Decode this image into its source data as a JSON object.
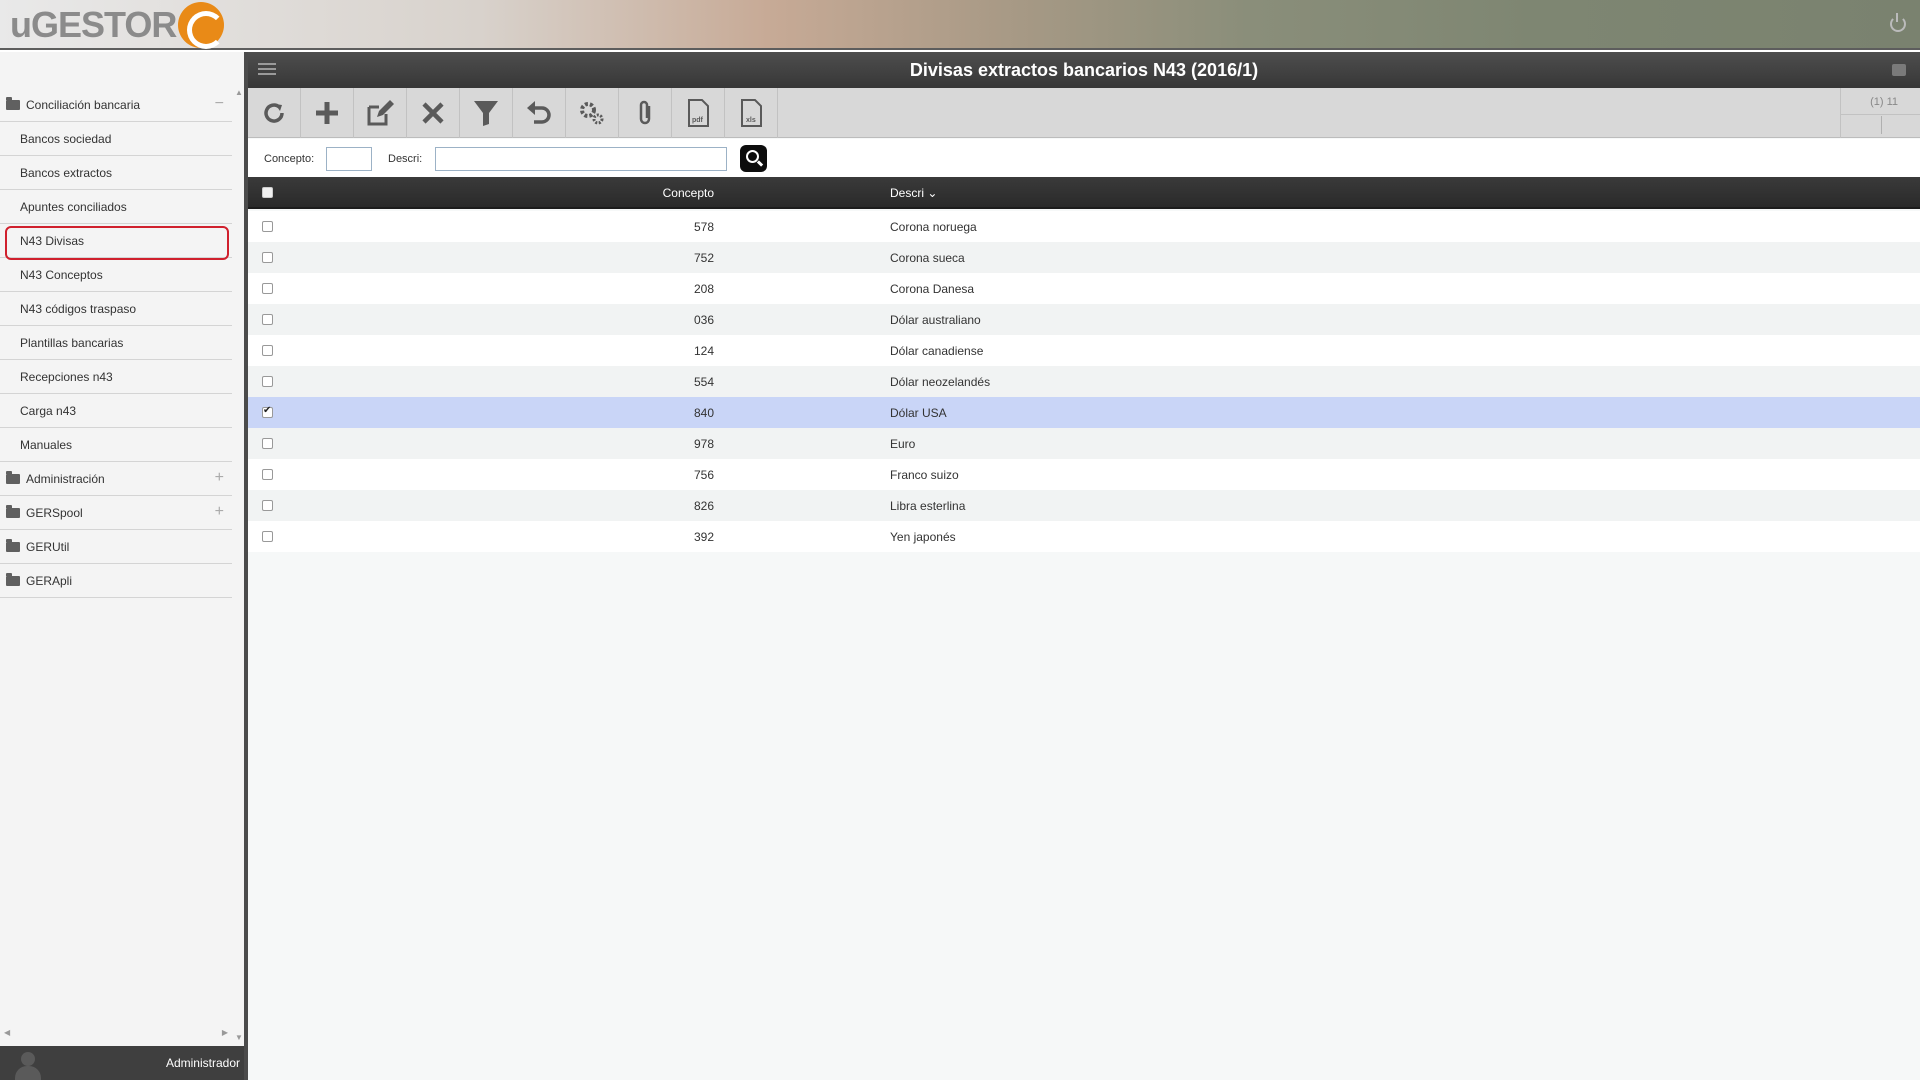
{
  "app": {
    "logo_text": "uGESTOR",
    "user_name": "Administrador"
  },
  "sidebar": {
    "items": [
      {
        "label": "Conciliación bancaria",
        "type": "group",
        "toggle": "−"
      },
      {
        "label": "Bancos sociedad",
        "type": "child"
      },
      {
        "label": "Bancos extractos",
        "type": "child"
      },
      {
        "label": "Apuntes conciliados",
        "type": "child"
      },
      {
        "label": "N43 Divisas",
        "type": "child",
        "selected": true
      },
      {
        "label": "N43 Conceptos",
        "type": "child"
      },
      {
        "label": "N43 códigos traspaso",
        "type": "child"
      },
      {
        "label": "Plantillas bancarias",
        "type": "child"
      },
      {
        "label": "Recepciones n43",
        "type": "child"
      },
      {
        "label": "Carga n43",
        "type": "child"
      },
      {
        "label": "Manuales",
        "type": "child"
      },
      {
        "label": "Administración",
        "type": "group",
        "toggle": "+"
      },
      {
        "label": "GERSpool",
        "type": "group",
        "toggle": "+"
      },
      {
        "label": "GERUtil",
        "type": "group"
      },
      {
        "label": "GERApli",
        "type": "group"
      }
    ]
  },
  "main": {
    "title": "Divisas extractos bancarios N43 (2016/1)",
    "pager_count": "(1) 11",
    "toolbar": [
      {
        "name": "refresh-button",
        "icon": "refresh-icon"
      },
      {
        "name": "add-button",
        "icon": "plus-icon"
      },
      {
        "name": "edit-button",
        "icon": "edit-icon"
      },
      {
        "name": "delete-button",
        "icon": "close-icon"
      },
      {
        "name": "filter-button",
        "icon": "funnel-icon"
      },
      {
        "name": "undo-button",
        "icon": "undo-icon"
      },
      {
        "name": "settings-button",
        "icon": "gears-icon"
      },
      {
        "name": "attach-button",
        "icon": "paperclip-icon"
      },
      {
        "name": "pdf-button",
        "icon": "pdf-file-icon",
        "label": "pdf"
      },
      {
        "name": "xls-button",
        "icon": "xls-file-icon",
        "label": "xls"
      }
    ],
    "filter": {
      "concepto_label": "Concepto:",
      "concepto_value": "",
      "descri_label": "Descri:",
      "descri_value": ""
    },
    "grid": {
      "columns": {
        "concepto": "Concepto",
        "descri": "Descri"
      },
      "sort_indicator": "⌄",
      "rows": [
        {
          "concepto": "578",
          "descri": "Corona noruega",
          "checked": false
        },
        {
          "concepto": "752",
          "descri": "Corona sueca",
          "checked": false
        },
        {
          "concepto": "208",
          "descri": "Corona Danesa",
          "checked": false
        },
        {
          "concepto": "036",
          "descri": "Dólar australiano",
          "checked": false
        },
        {
          "concepto": "124",
          "descri": "Dólar canadiense",
          "checked": false
        },
        {
          "concepto": "554",
          "descri": "Dólar neozelandés",
          "checked": false
        },
        {
          "concepto": "840",
          "descri": "Dólar USA",
          "checked": true
        },
        {
          "concepto": "978",
          "descri": "Euro",
          "checked": false
        },
        {
          "concepto": "756",
          "descri": "Franco suizo",
          "checked": false
        },
        {
          "concepto": "826",
          "descri": "Libra esterlina",
          "checked": false
        },
        {
          "concepto": "392",
          "descri": "Yen japonés",
          "checked": false
        }
      ]
    }
  },
  "colors": {
    "accent_orange": "#e98a17",
    "selection_outline": "#d0202d",
    "selected_row": "#c9d5f7"
  }
}
